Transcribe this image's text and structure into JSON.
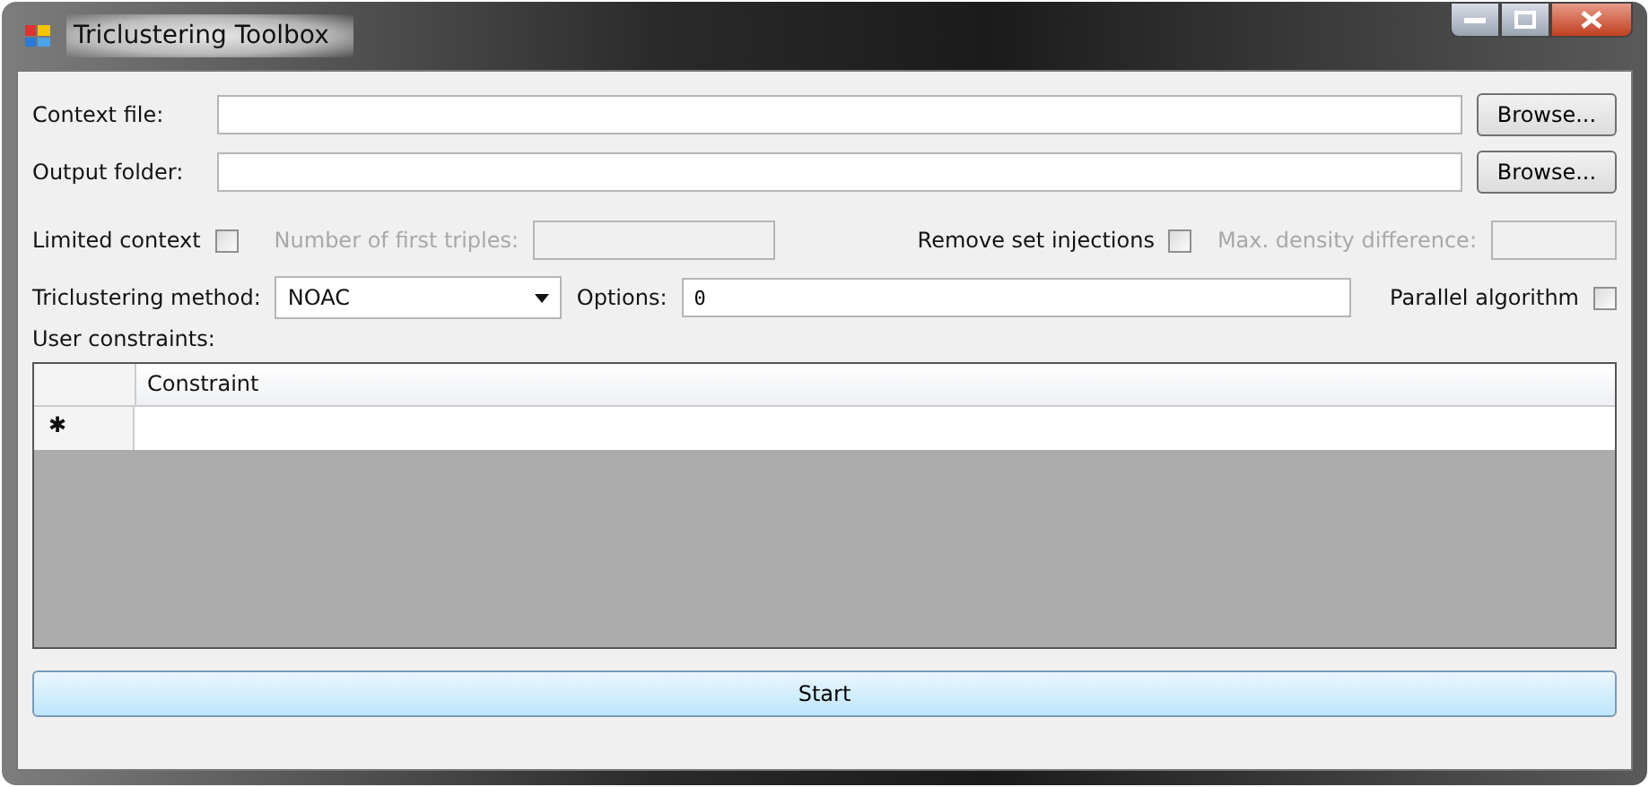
{
  "window": {
    "title": "Triclustering Toolbox"
  },
  "context_file": {
    "label": "Context file:",
    "button": "Browse..."
  },
  "output_folder": {
    "label": "Output folder:",
    "button": "Browse..."
  },
  "limited_context": {
    "label": "Limited context",
    "checked": false
  },
  "first_triples": {
    "label": "Number of first triples:",
    "disabled": true
  },
  "remove_set_injections": {
    "label": "Remove set injections",
    "checked": false
  },
  "max_density": {
    "label": "Max. density difference:",
    "disabled": true
  },
  "method": {
    "label": "Triclustering method:",
    "value": "NOAC"
  },
  "options": {
    "label": "Options:",
    "value": "0"
  },
  "parallel": {
    "label": "Parallel algorithm",
    "checked": false
  },
  "constraints": {
    "label": "User constraints:",
    "columns": [
      "Constraint"
    ],
    "new_row_marker": "✱"
  },
  "start_button": "Start"
}
